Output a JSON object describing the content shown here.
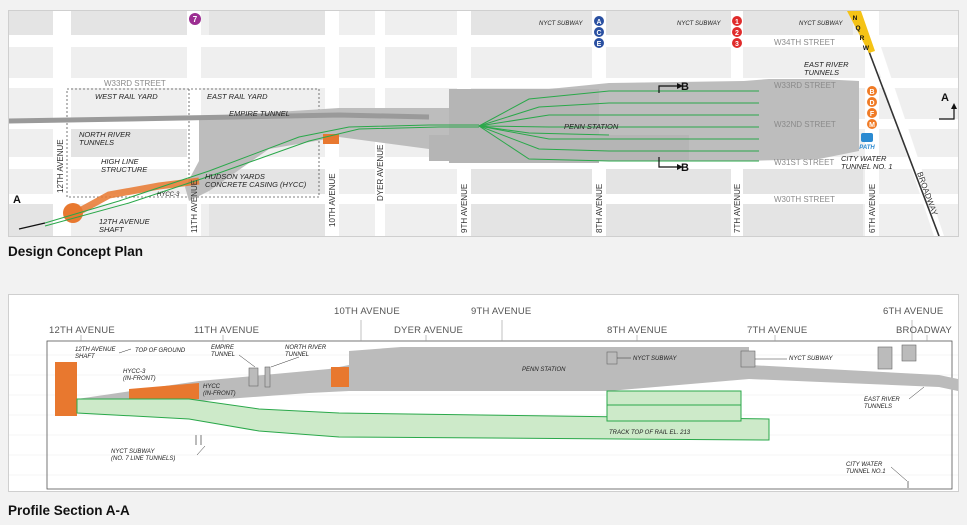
{
  "captions": {
    "plan": "Design Concept Plan",
    "profile": "Profile Section A-A"
  },
  "plan": {
    "streets": {
      "w34": "W34TH STREET",
      "w33": "W33RD STREET",
      "w33b": "W33RD STREET",
      "w32": "W32ND STREET",
      "w31": "W31ST STREET",
      "w30": "W30TH STREET"
    },
    "avenues": {
      "ave12": "12TH AVENUE",
      "ave11": "11TH AVENUE",
      "ave10": "10TH AVENUE",
      "dyer": "DYER AVENUE",
      "ave9": "9TH AVENUE",
      "ave8": "8TH AVENUE",
      "ave7": "7TH AVENUE",
      "ave6": "6TH AVENUE",
      "broadway": "BROADWAY"
    },
    "labels": {
      "west_rail_yard": "WEST RAIL YARD",
      "east_rail_yard": "EAST RAIL YARD",
      "empire_tunnel": "EMPIRE TUNNEL",
      "north_river_tunnels_1": "NORTH RIVER",
      "north_river_tunnels_2": "TUNNELS",
      "high_line_1": "HIGH LINE",
      "high_line_2": "STRUCTURE",
      "hycc3": "HYCC-3",
      "hycc_1": "HUDSON YARDS",
      "hycc_2": "CONCRETE CASING (HYCC)",
      "shaft_1": "12TH AVENUE",
      "shaft_2": "SHAFT",
      "penn_station": "PENN STATION",
      "east_river_1": "EAST RIVER",
      "east_river_2": "TUNNELS",
      "city_water_1": "CITY WATER",
      "city_water_2": "TUNNEL NO. 1",
      "nyct_subway_a": "NYCT SUBWAY",
      "nyct_subway_b": "NYCT SUBWAY",
      "nyct_subway_c": "NYCT SUBWAY",
      "path": "PATH",
      "section_a": "A",
      "section_b": "B"
    },
    "subway_lines": {
      "line7": "7",
      "ace": [
        "A",
        "C",
        "E"
      ],
      "l123": [
        "1",
        "2",
        "3"
      ],
      "nqrw": [
        "N",
        "Q",
        "R",
        "W"
      ],
      "bdfm": [
        "B",
        "D",
        "F",
        "M"
      ]
    },
    "colors": {
      "line7": "#9c2e92",
      "ace": "#2a50a1",
      "l123": "#e02b2b",
      "nqrw": "#f5c316",
      "bdfm": "#f07b26",
      "path": "#2b8ad1",
      "tracks": "#2aa84a",
      "station": "#b7b7b7",
      "shaft": "#e8782f"
    }
  },
  "profile": {
    "avenues": {
      "ave12": "12TH AVENUE",
      "ave11": "11TH AVENUE",
      "ave10": "10TH AVENUE",
      "dyer": "DYER AVENUE",
      "ave9": "9TH AVENUE",
      "ave8": "8TH AVENUE",
      "ave7": "7TH AVENUE",
      "ave6": "6TH AVENUE",
      "broadway": "BROADWAY"
    },
    "labels": {
      "shaft_1": "12TH AVENUE",
      "shaft_2": "SHAFT",
      "top_of_ground": "TOP OF GROUND",
      "empire_1": "EMPIRE",
      "empire_2": "TUNNEL",
      "north_river_1": "NORTH RIVER",
      "north_river_2": "TUNNEL",
      "hycc3_1": "HYCC-3",
      "hycc3_2": "(IN-FRONT)",
      "hycc_1": "HYCC",
      "hycc_2": "(IN-FRONT)",
      "penn_station": "PENN STATION",
      "nyct_subway_8": "NYCT SUBWAY",
      "nyct_subway_7": "NYCT SUBWAY",
      "track_top": "TRACK TOP OF RAIL EL. 213",
      "nyct_subway_7line_1": "NYCT SUBWAY",
      "nyct_subway_7line_2": "(NO. 7 LINE TUNNELS)",
      "east_river_1": "EAST RIVER",
      "east_river_2": "TUNNELS",
      "city_water_1": "CITY WATER",
      "city_water_2": "TUNNEL NO.1"
    }
  }
}
